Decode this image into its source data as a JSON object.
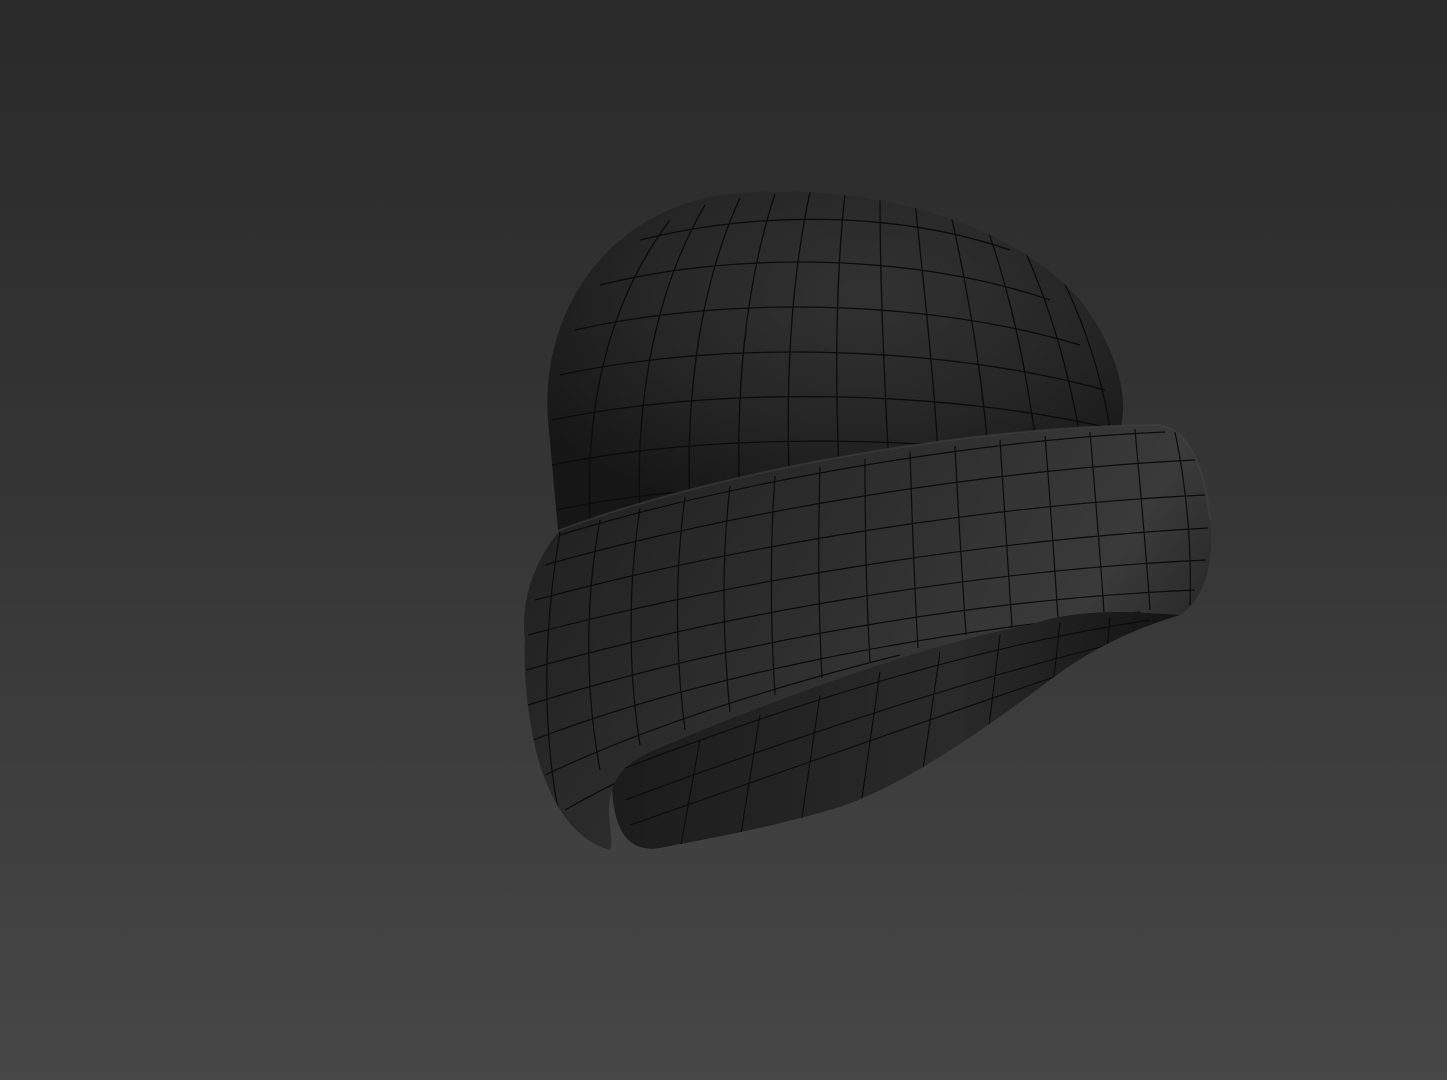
{
  "scene": {
    "object": "beanie-hat",
    "render_style": "wireframe-on-shaded",
    "colors": {
      "background_top": "#2a2a2a",
      "background_bottom": "#474747",
      "surface_dark": "#1a1a1a",
      "surface_mid": "#2a2a2a",
      "surface_light": "#3a3a3a",
      "wire": "#0b0b0b"
    }
  }
}
